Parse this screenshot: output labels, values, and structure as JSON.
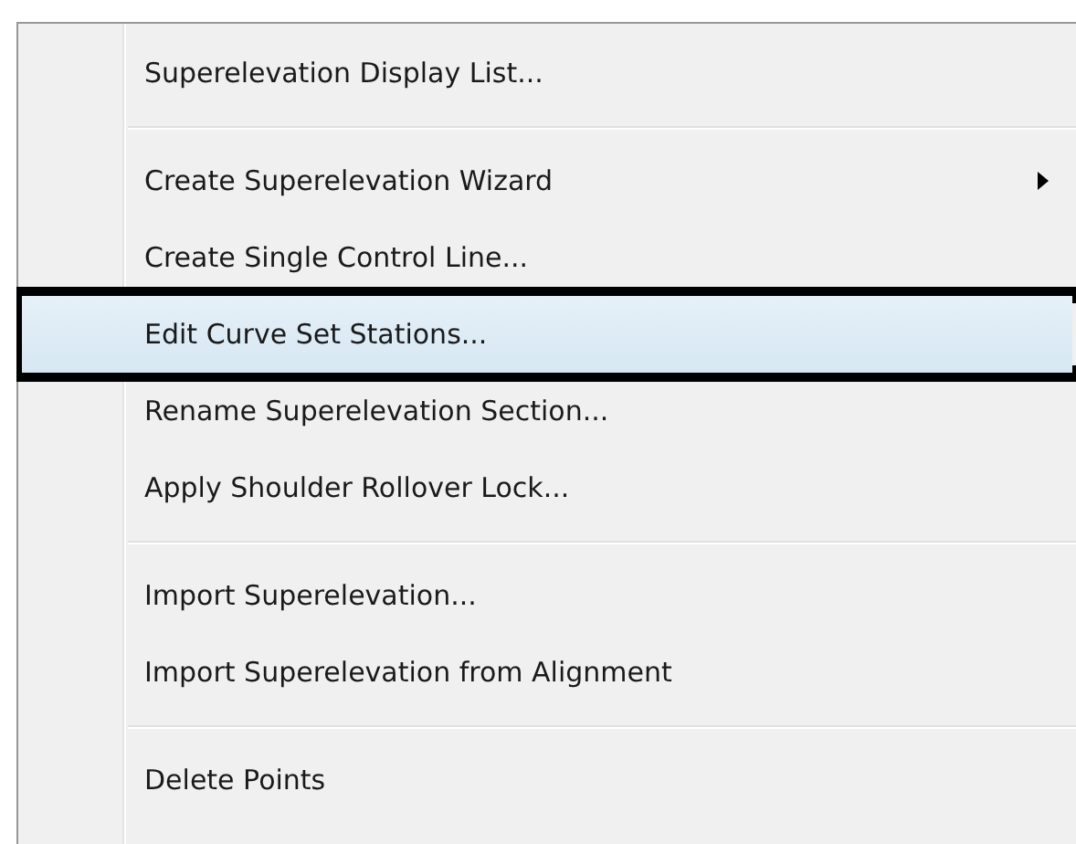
{
  "menu": {
    "items": [
      {
        "kind": "item",
        "label": "Superelevation Display List...",
        "has_submenu": false,
        "selected": false,
        "annotated": false
      },
      {
        "kind": "separator"
      },
      {
        "kind": "item",
        "label": "Create Superelevation Wizard",
        "has_submenu": true,
        "selected": false,
        "annotated": false
      },
      {
        "kind": "item",
        "label": "Create Single Control Line...",
        "has_submenu": false,
        "selected": false,
        "annotated": false
      },
      {
        "kind": "item",
        "label": "Edit Curve Set Stations...",
        "has_submenu": false,
        "selected": true,
        "annotated": true
      },
      {
        "kind": "item",
        "label": "Rename Superelevation Section...",
        "has_submenu": false,
        "selected": false,
        "annotated": false
      },
      {
        "kind": "item",
        "label": "Apply Shoulder Rollover Lock...",
        "has_submenu": false,
        "selected": false,
        "annotated": false
      },
      {
        "kind": "separator"
      },
      {
        "kind": "item",
        "label": "Import Superelevation...",
        "has_submenu": false,
        "selected": false,
        "annotated": false
      },
      {
        "kind": "item",
        "label": "Import Superelevation from Alignment",
        "has_submenu": false,
        "selected": false,
        "annotated": false
      },
      {
        "kind": "separator"
      },
      {
        "kind": "item",
        "label": "Delete Points",
        "has_submenu": false,
        "selected": false,
        "annotated": false
      }
    ]
  }
}
